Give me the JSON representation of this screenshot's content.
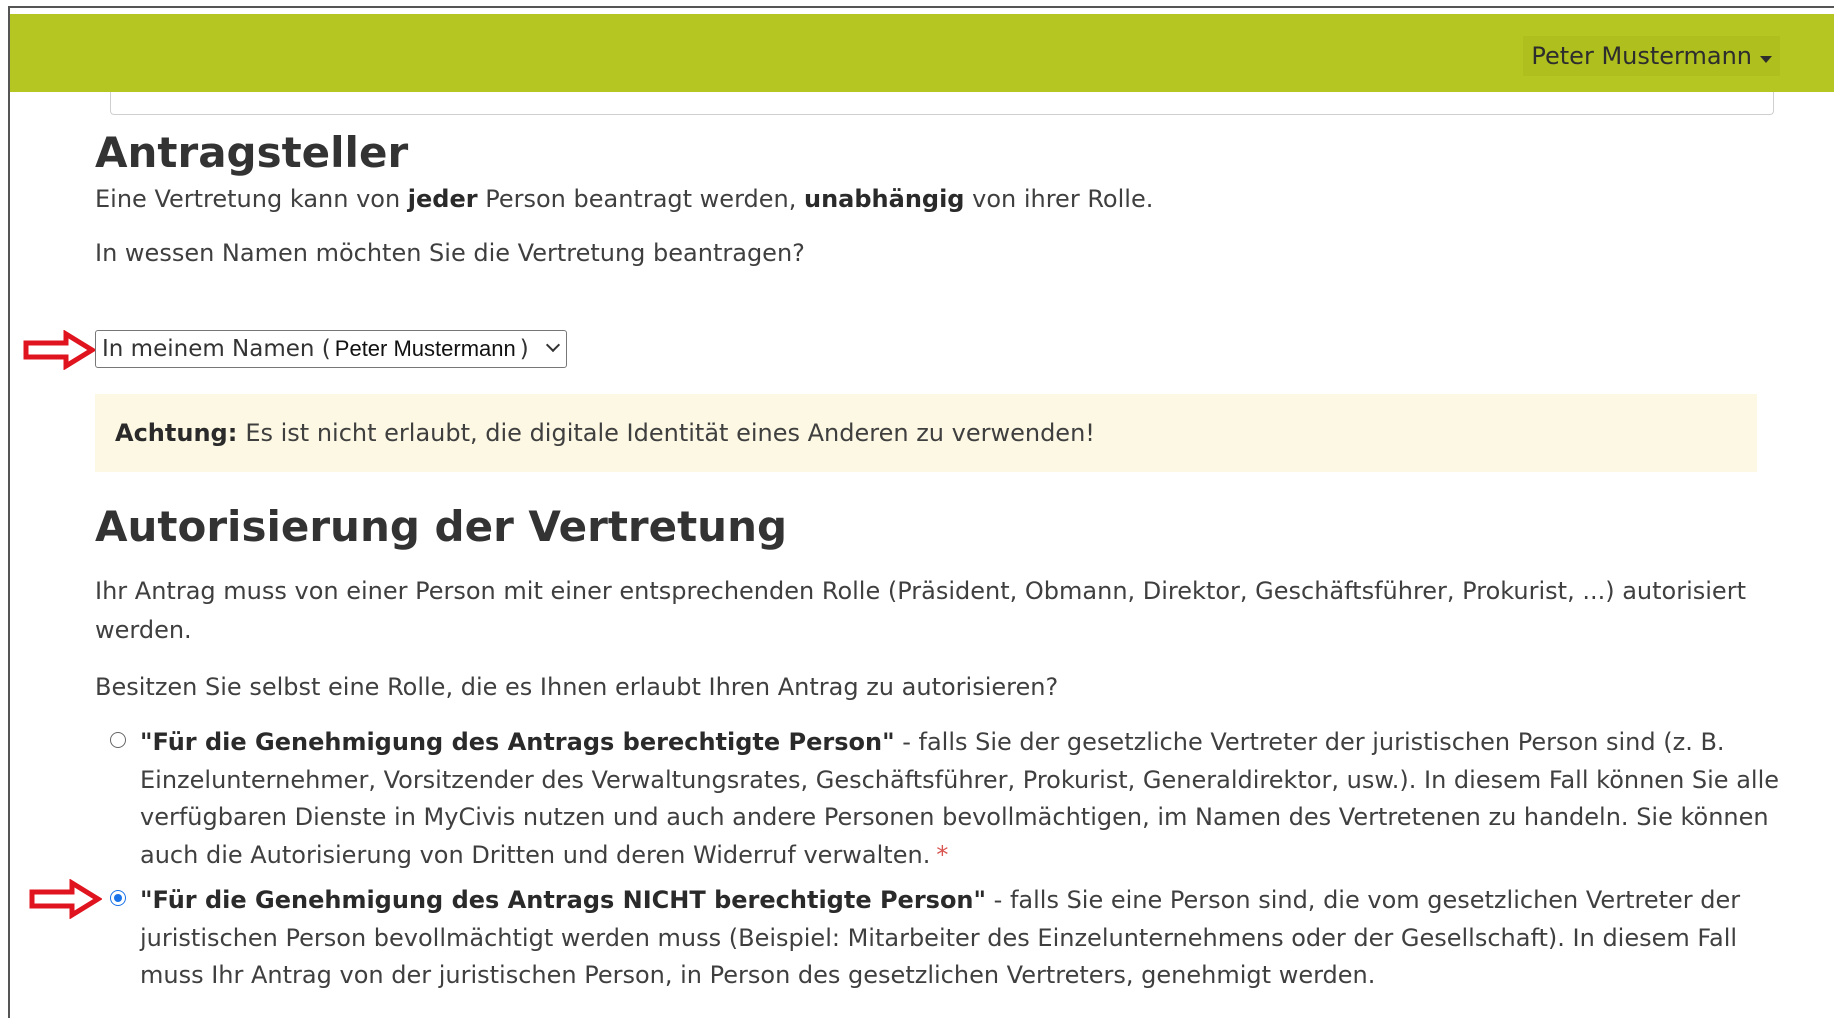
{
  "header": {
    "user_name": "Peter Mustermann"
  },
  "colors": {
    "topbar": "#b5c521",
    "alert_bg": "#fcf8e3",
    "arrow": "#e0141e",
    "radio_checked": "#1a73e8"
  },
  "applicant": {
    "heading": "Antragsteller",
    "intro_1": "Eine Vertretung kann von ",
    "intro_bold_1": "jeder",
    "intro_2": " Person beantragt werden, ",
    "intro_bold_2": "unabhängig",
    "intro_3": " von ihrer Rolle.",
    "question": "In wessen Namen möchten Sie die Vertretung beantragen?",
    "select_prefix": "In meinem Namen (",
    "select_name": "Peter Mustermann",
    "select_suffix": ")",
    "alert_label": "Achtung:",
    "alert_text": "Es ist nicht erlaubt, die digitale Identität eines Anderen zu verwenden!"
  },
  "authorization": {
    "heading": "Autorisierung der Vertretung",
    "intro": "Ihr Antrag muss von einer Person mit einer entsprechenden Rolle (Präsident, Obmann, Direktor, Geschäftsführer, Prokurist, ...) autorisiert werden.",
    "question": "Besitzen Sie selbst eine Rolle, die es Ihnen erlaubt Ihren Antrag zu autorisieren?",
    "options": [
      {
        "title": "\"Für die Genehmigung des Antrags berechtigte Person\"",
        "text": " - falls Sie der gesetzliche Vertreter der juristischen Person sind (z. B. Einzelunternehmer, Vorsitzender des Verwaltungsrates, Geschäftsführer, Prokurist, Generaldirektor, usw.). In diesem Fall können Sie alle verfügbaren Dienste in MyCivis nutzen und auch andere Personen bevollmächtigen, im Namen des Vertretenen zu handeln. Sie können auch die Autorisierung von Dritten und deren Widerruf verwalten.",
        "required_mark": "*",
        "checked": false
      },
      {
        "title": "\"Für die Genehmigung des Antrags NICHT berechtigte Person\"",
        "text": " - falls Sie eine Person sind, die vom gesetzlichen Vertreter der juristischen Person bevollmächtigt werden muss (Beispiel: Mitarbeiter des Einzelunternehmens oder der Gesellschaft). In diesem Fall muss Ihr Antrag von der juristischen Person, in Person des gesetzlichen Vertreters, genehmigt werden.",
        "checked": true
      }
    ]
  }
}
